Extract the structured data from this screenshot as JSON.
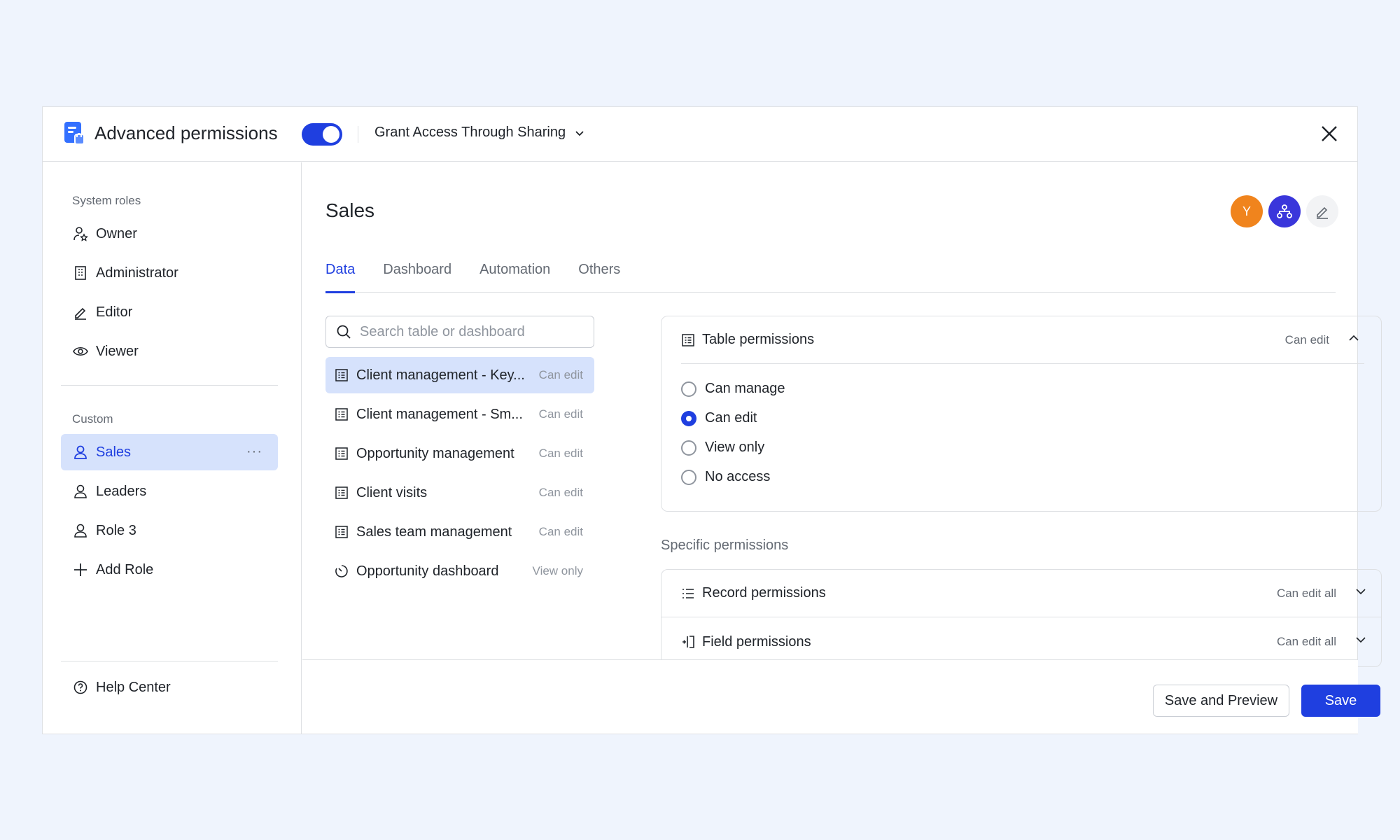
{
  "header": {
    "title": "Advanced permissions",
    "toggle_on": true,
    "grant_label": "Grant Access Through Sharing"
  },
  "sidebar": {
    "system_label": "System roles",
    "system_roles": [
      "Owner",
      "Administrator",
      "Editor",
      "Viewer"
    ],
    "custom_label": "Custom",
    "custom_roles": [
      "Sales",
      "Leaders",
      "Role 3"
    ],
    "add_role": "Add Role",
    "help": "Help Center"
  },
  "main": {
    "role_title": "Sales",
    "avatar_initial": "Y",
    "tabs": [
      "Data",
      "Dashboard",
      "Automation",
      "Others"
    ],
    "search_placeholder": "Search table or dashboard",
    "tables": [
      {
        "name": "Client management - Key...",
        "perm": "Can edit"
      },
      {
        "name": "Client management - Sm...",
        "perm": "Can edit"
      },
      {
        "name": "Opportunity management",
        "perm": "Can edit"
      },
      {
        "name": "Client visits",
        "perm": "Can edit"
      },
      {
        "name": "Sales team management",
        "perm": "Can edit"
      },
      {
        "name": "Opportunity dashboard",
        "perm": "View only"
      }
    ],
    "table_permissions": {
      "title": "Table permissions",
      "value": "Can edit",
      "options": [
        "Can manage",
        "Can edit",
        "View only",
        "No access"
      ],
      "selected": "Can edit"
    },
    "specific_label": "Specific permissions",
    "record_permissions": {
      "title": "Record permissions",
      "value": "Can edit all"
    },
    "field_permissions": {
      "title": "Field permissions",
      "value": "Can edit all"
    }
  },
  "footer": {
    "save_preview": "Save and Preview",
    "save": "Save"
  },
  "colors": {
    "accent": "#1f3fe0",
    "avatar_orange": "#f0841d",
    "avatar_blue": "#3a36db",
    "active_bg": "#d6e2fc"
  }
}
